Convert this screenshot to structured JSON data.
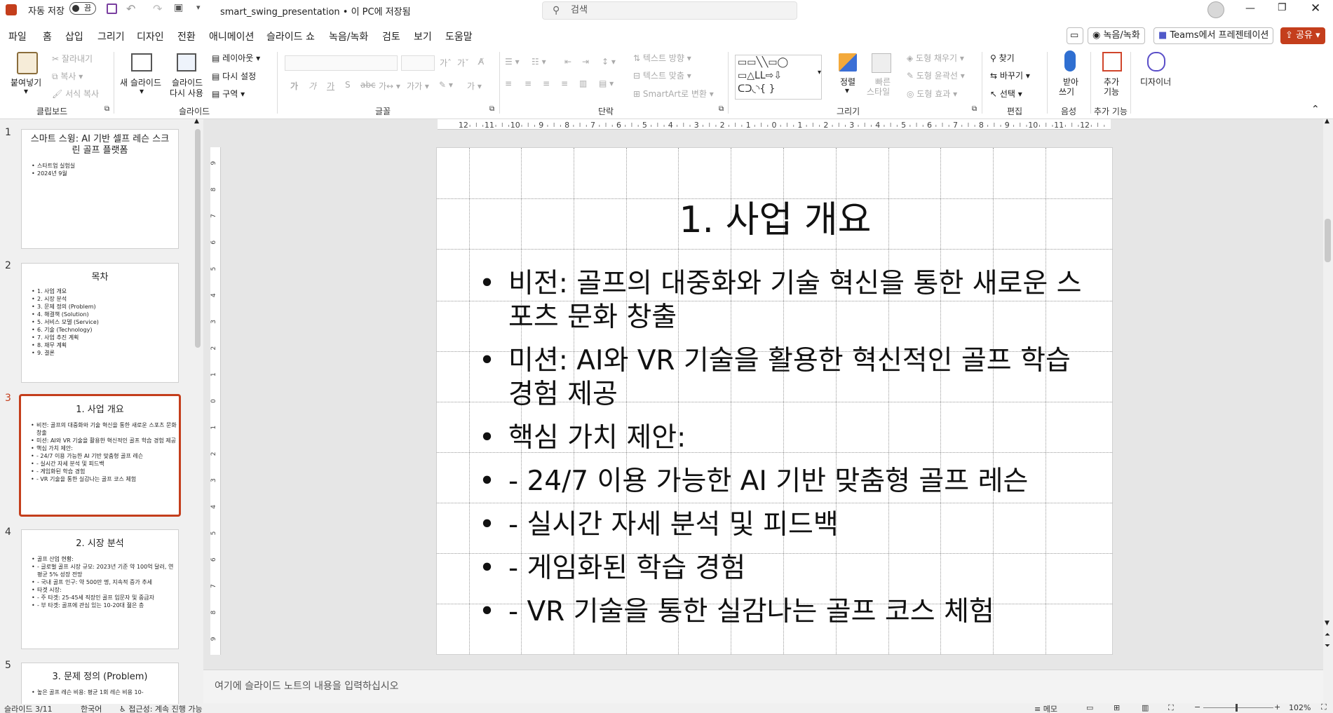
{
  "titlebar": {
    "autosave_label": "자동 저장",
    "autosave_state": "끔",
    "filename": "smart_swing_presentation • 이 PC에 저장됨",
    "search_placeholder": "검색"
  },
  "menu": {
    "tabs": [
      "파일",
      "홈",
      "삽입",
      "그리기",
      "디자인",
      "전환",
      "애니메이션",
      "슬라이드 쇼",
      "녹음/녹화",
      "검토",
      "보기",
      "도움말"
    ],
    "active_tab": "홈",
    "record_label": "녹음/녹화",
    "teams_label": "Teams에서 프레젠테이션",
    "share_label": "공유"
  },
  "ribbon": {
    "clipboard": {
      "group": "클립보드",
      "paste": "붙여넣기",
      "cut": "잘라내기",
      "copy": "복사",
      "format_painter": "서식 복사"
    },
    "slides": {
      "group": "슬라이드",
      "new_slide": "새 슬라이드",
      "reuse": "슬라이드 다시 사용",
      "reuse_line1": "슬라이드",
      "reuse_line2": "다시 사용",
      "layout": "레이아웃",
      "reset": "다시 설정",
      "section": "구역"
    },
    "font": {
      "group": "글꼴"
    },
    "paragraph": {
      "group": "단락",
      "text_direction": "텍스트 방향",
      "align_text": "텍스트 맞춤",
      "smartart": "SmartArt로 변환"
    },
    "drawing": {
      "group": "그리기",
      "arrange": "정렬",
      "quick_styles": "빠른 스타일",
      "quick_styles_l1": "빠른",
      "quick_styles_l2": "스타일",
      "fill": "도형 채우기",
      "outline": "도형 윤곽선",
      "effects": "도형 효과"
    },
    "editing": {
      "group": "편집",
      "find": "찾기",
      "replace": "바꾸기",
      "select": "선택"
    },
    "voice": {
      "group": "음성",
      "dictate": "받아 쓰기",
      "dictate_l1": "받아",
      "dictate_l2": "쓰기"
    },
    "addins": {
      "group": "추가 기능",
      "addins": "추가 기능",
      "addins_l1": "추가",
      "addins_l2": "기능"
    },
    "designer": {
      "label": "디자이너"
    }
  },
  "thumbnails": [
    {
      "num": "1",
      "title": "스마트 스윙: AI 기반 셀프 레슨 스크린 골프 플랫폼",
      "bullets": [
        "스타트업 실험실",
        "2024년 9월"
      ]
    },
    {
      "num": "2",
      "title": "목차",
      "bullets": [
        "1. 사업 개요",
        "2. 시장 분석",
        "3. 문제 정의 (Problem)",
        "4. 해결책 (Solution)",
        "5. 서비스 모델 (Service)",
        "6. 기술 (Technology)",
        "7. 사업 추진 계획",
        "8. 재무 계획",
        "9. 결론"
      ]
    },
    {
      "num": "3",
      "title": "1. 사업 개요",
      "bullets": [
        "비전: 골프의 대중화와 기술 혁신을 통한 새로운 스포츠 문화 창출",
        "미션: AI와 VR 기술을 활용한 혁신적인 골프 학습 경험 제공",
        "핵심 가치 제안:",
        "- 24/7 이용 가능한 AI 기반 맞춤형 골프 레슨",
        "- 실시간 자세 분석 및 피드백",
        "- 게임화된 학습 경험",
        "- VR 기술을 통한 실감나는 골프 코스 체험"
      ]
    },
    {
      "num": "4",
      "title": "2. 시장 분석",
      "bullets": [
        "골프 산업 현황:",
        "- 글로벌 골프 시장 규모: 2023년 기준 약 100억 달러, 연평균 5% 성장 전망",
        "- 국내 골프 인구: 약 500만 명, 지속적 증가 추세",
        "타겟 시장:",
        "- 주 타겟: 25-45세 직장인 골프 입문자 및 중급자",
        "- 부 타겟: 골프에 관심 있는 10-20대 젊은 층"
      ]
    },
    {
      "num": "5",
      "title": "3. 문제 정의 (Problem)",
      "bullets": [
        "높은 골프 레슨 비용: 평균 1회 레슨 비용 10-"
      ]
    }
  ],
  "slide": {
    "title": "1. 사업 개요",
    "bullets": [
      "비전: 골프의 대중화와 기술 혁신을 통한 새로운 스포츠 문화 창출",
      "미션: AI와 VR 기술을 활용한 혁신적인 골프 학습 경험 제공",
      "핵심 가치 제안:",
      "- 24/7 이용 가능한 AI 기반 맞춤형 골프 레슨",
      "- 실시간 자세 분석 및 피드백",
      "- 게임화된 학습 경험",
      "- VR 기술을 통한 실감나는 골프 코스 체험"
    ]
  },
  "ruler": {
    "h_labels": [
      "12",
      "11",
      "10",
      "9",
      "8",
      "7",
      "6",
      "5",
      "4",
      "3",
      "2",
      "1",
      "0",
      "1",
      "2",
      "3",
      "4",
      "5",
      "6",
      "7",
      "8",
      "9",
      "10",
      "11",
      "12"
    ],
    "v_labels": [
      "9",
      "8",
      "7",
      "6",
      "5",
      "4",
      "3",
      "2",
      "1",
      "0",
      "1",
      "2",
      "3",
      "4",
      "5",
      "6",
      "7",
      "8",
      "9"
    ]
  },
  "notes": {
    "placeholder": "여기에 슬라이드 노트의 내용을 입력하십시오"
  },
  "status": {
    "slide_info": "슬라이드 3/11",
    "language": "한국어",
    "accessibility": "접근성: 계속 진행 가능",
    "notes_btn": "메모",
    "zoom": "102%"
  }
}
